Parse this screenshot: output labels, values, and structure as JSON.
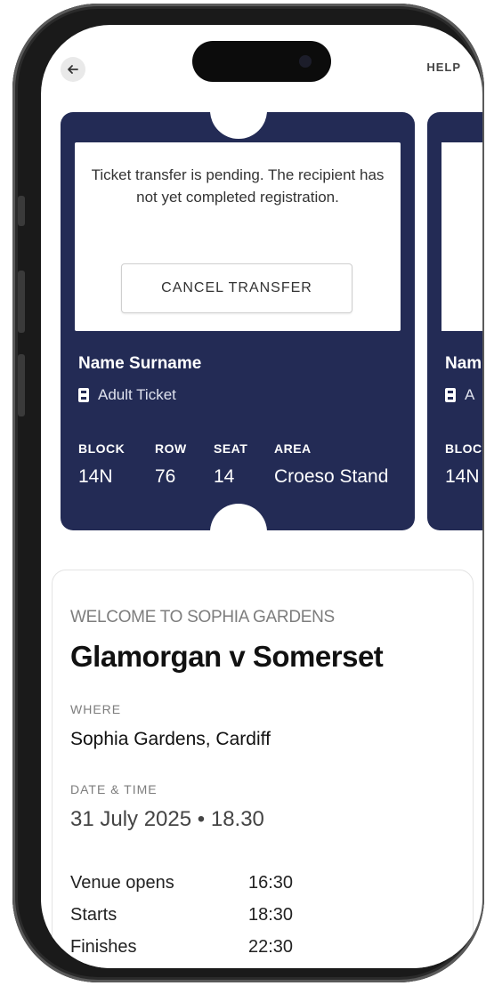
{
  "header": {
    "help_label": "HELP"
  },
  "ticket": {
    "pending_message": "Ticket transfer is pending. The recipient has not yet completed registration.",
    "cancel_label": "CANCEL TRANSFER",
    "holder_name": "Name Surname",
    "ticket_type": "Adult Ticket",
    "fields": [
      {
        "label": "BLOCK",
        "value": "14N"
      },
      {
        "label": "ROW",
        "value": "76"
      },
      {
        "label": "SEAT",
        "value": "14"
      },
      {
        "label": "AREA",
        "value": "Croeso Stand"
      }
    ]
  },
  "ticket_peek": {
    "holder_name": "Nam",
    "ticket_type": "A",
    "block_label": "BLOC",
    "block_value": "14N"
  },
  "event": {
    "welcome": "WELCOME TO SOPHIA GARDENS",
    "title": "Glamorgan v Somerset",
    "where_label": "WHERE",
    "where_value": "Sophia Gardens, Cardiff",
    "datetime_label": "DATE & TIME",
    "datetime_value": "31 July 2025 • 18.30",
    "schedule": [
      {
        "label": "Venue opens",
        "time": "16:30"
      },
      {
        "label": "Starts",
        "time": "18:30"
      },
      {
        "label": "Finishes",
        "time": "22:30"
      }
    ]
  },
  "colors": {
    "ticket_bg": "#232b55",
    "accent_text": "#111111"
  }
}
